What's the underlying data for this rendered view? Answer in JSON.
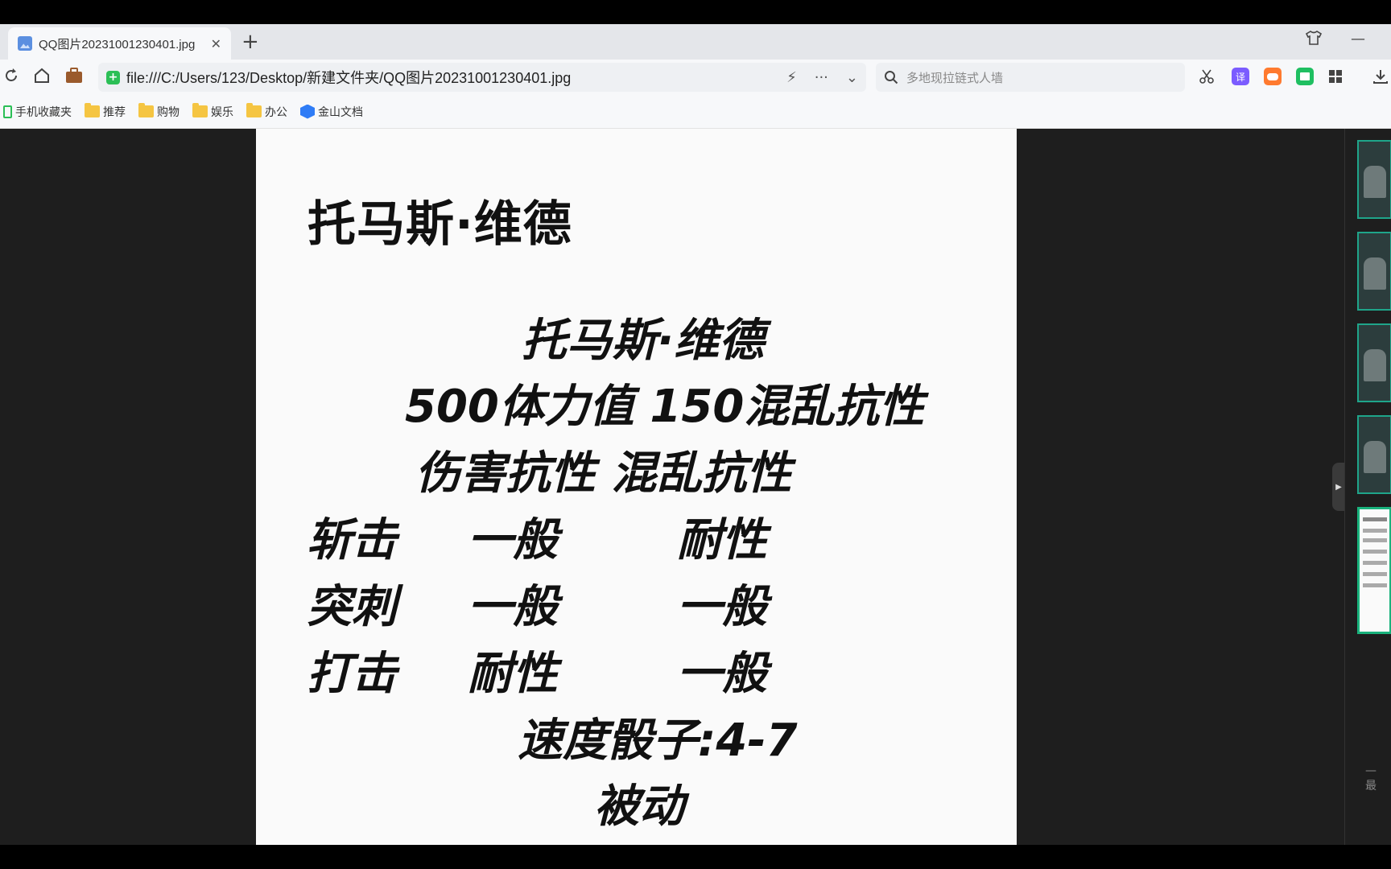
{
  "tab": {
    "title": "QQ图片20231001230401.jpg",
    "close": "✕",
    "new_tab": "+"
  },
  "window": {
    "minimize": "—"
  },
  "address": {
    "url": "file:///C:/Users/123/Desktop/新建文件夹/QQ图片20231001230401.jpg",
    "more": "···",
    "dropdown": "⌄",
    "bolt": "⚡"
  },
  "search": {
    "placeholder": "多地现拉链式人墙"
  },
  "extensions": {
    "translate": "译"
  },
  "bookmarks": [
    {
      "label": "手机收藏夹",
      "icon": "phone-icon"
    },
    {
      "label": "推荐",
      "icon": "folder-icon"
    },
    {
      "label": "购物",
      "icon": "folder-icon"
    },
    {
      "label": "娱乐",
      "icon": "folder-icon"
    },
    {
      "label": "办公",
      "icon": "folder-icon"
    },
    {
      "label": "金山文档",
      "icon": "wps-icon"
    }
  ],
  "image": {
    "heading": "托马斯·维德",
    "name_line": "托马斯·维德",
    "stats_line": "500体力值   150混乱抗性",
    "resist_header": "伤害抗性     混乱抗性",
    "rows": [
      {
        "type": "斩击",
        "damage": "一般",
        "confusion": "耐性"
      },
      {
        "type": "突刺",
        "damage": "一般",
        "confusion": "一般"
      },
      {
        "type": "打击",
        "damage": "耐性",
        "confusion": "一般"
      }
    ],
    "speed": "速度骰子:4-7",
    "passive": "被动"
  },
  "thumbnails": {
    "footer": "— 最"
  }
}
